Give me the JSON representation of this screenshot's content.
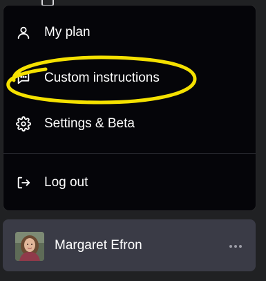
{
  "menu": {
    "items": [
      {
        "label": "My plan",
        "icon": "user-icon"
      },
      {
        "label": "Custom instructions",
        "icon": "message-square-icon"
      },
      {
        "label": "Settings & Beta",
        "icon": "gear-icon"
      },
      {
        "label": "Log out",
        "icon": "logout-icon"
      }
    ]
  },
  "user": {
    "name": "Margaret Efron",
    "avatar": "user-photo"
  },
  "colors": {
    "menu_bg": "#050509",
    "user_card_bg": "#3a3b46",
    "highlight": "#f5e100",
    "text": "#ffffff"
  }
}
